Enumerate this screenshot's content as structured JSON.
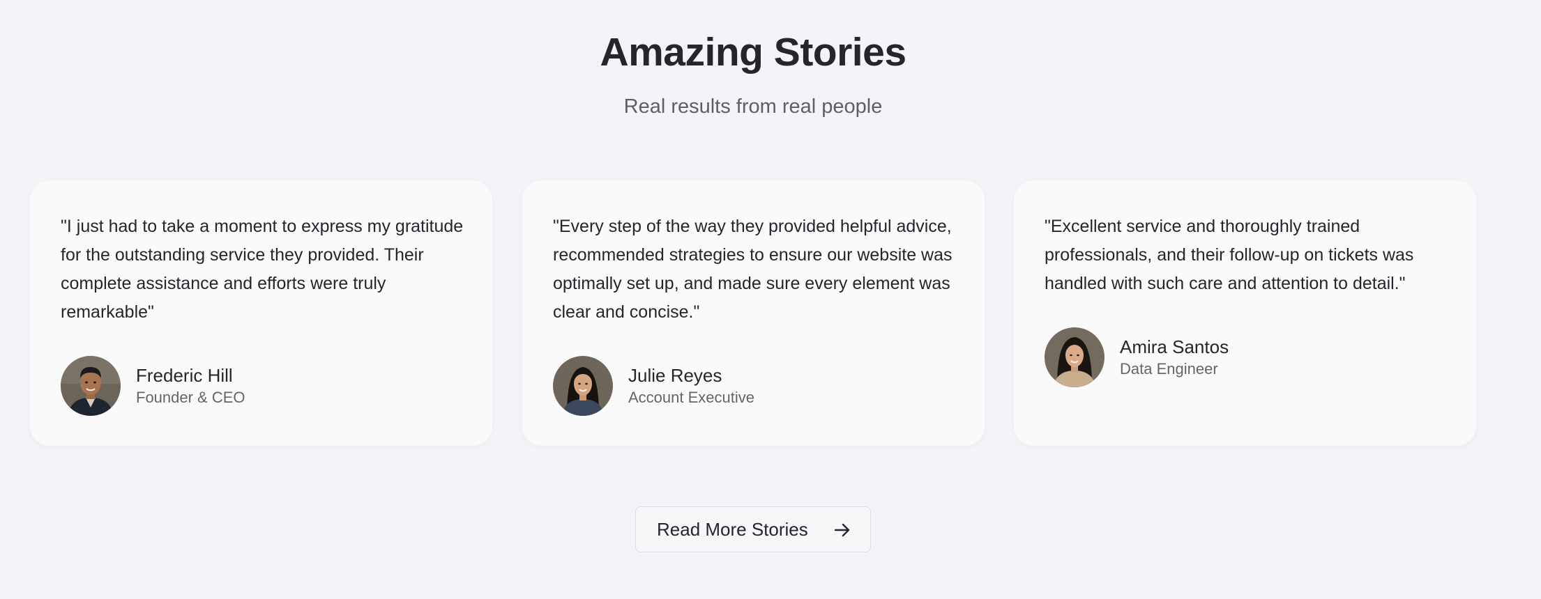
{
  "section": {
    "title": "Amazing Stories",
    "subtitle": "Real results from real people"
  },
  "testimonials": [
    {
      "quote": "\"I just had to take a moment to express my gratitude for the outstanding service they provided. Their complete assistance and efforts were truly remarkable\"",
      "name": "Frederic Hill",
      "role": "Founder & CEO",
      "avatar": "man-portrait-avatar"
    },
    {
      "quote": "\"Every step of the way they provided helpful advice, recommended strategies to ensure our website was optimally set up, and made sure every element was clear and concise.\"",
      "name": "Julie Reyes",
      "role": "Account Executive",
      "avatar": "woman-portrait-avatar"
    },
    {
      "quote": "\"Excellent service and thoroughly trained professionals, and their follow-up on tickets was handled with such care and attention to detail.\"",
      "name": "Amira Santos",
      "role": "Data Engineer",
      "avatar": "woman-portrait-avatar"
    }
  ],
  "cta": {
    "label": "Read More Stories",
    "icon": "arrow-right-icon"
  },
  "colors": {
    "background": "#f4f4f8",
    "card": "#fafafa",
    "text": "#25262c",
    "muted": "#64656c"
  }
}
